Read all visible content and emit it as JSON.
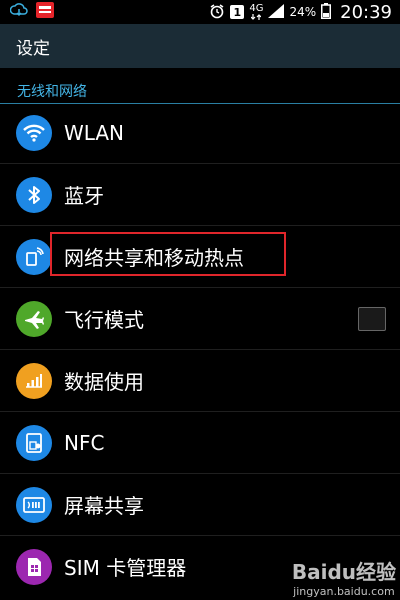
{
  "status_bar": {
    "icons_left": [
      "cloud-sync-icon",
      "news-app-icon"
    ],
    "alarm_icon": "alarm-icon",
    "notification_badge": "1",
    "network_type": "4G",
    "signal_icon": "signal-icon",
    "battery_percent": "24%",
    "time": "20:39"
  },
  "header": {
    "title": "设定"
  },
  "section": {
    "title": "无线和网络"
  },
  "settings_items": [
    {
      "label": "WLAN",
      "icon": "wifi-icon",
      "color": "#1e88e5"
    },
    {
      "label": "蓝牙",
      "icon": "bluetooth-icon",
      "color": "#1e88e5"
    },
    {
      "label": "网络共享和移动热点",
      "icon": "hotspot-icon",
      "color": "#1e88e5"
    },
    {
      "label": "飞行模式",
      "icon": "airplane-icon",
      "color": "#4fa82a",
      "toggle": false
    },
    {
      "label": "数据使用",
      "icon": "data-usage-icon",
      "color": "#f0a020"
    },
    {
      "label": "NFC",
      "icon": "nfc-icon",
      "color": "#1e88e5"
    },
    {
      "label": "屏幕共享",
      "icon": "screen-share-icon",
      "color": "#1e88e5"
    },
    {
      "label": "SIM 卡管理器",
      "icon": "sim-card-icon",
      "color": "#9c27b0"
    }
  ],
  "watermark": {
    "text": "Baidu经验",
    "url_text": "jingyan.baidu.com"
  },
  "colors": {
    "title_bar": "#1b2c36",
    "section_text": "#44b5e6",
    "highlight_box": "#e0262b"
  }
}
